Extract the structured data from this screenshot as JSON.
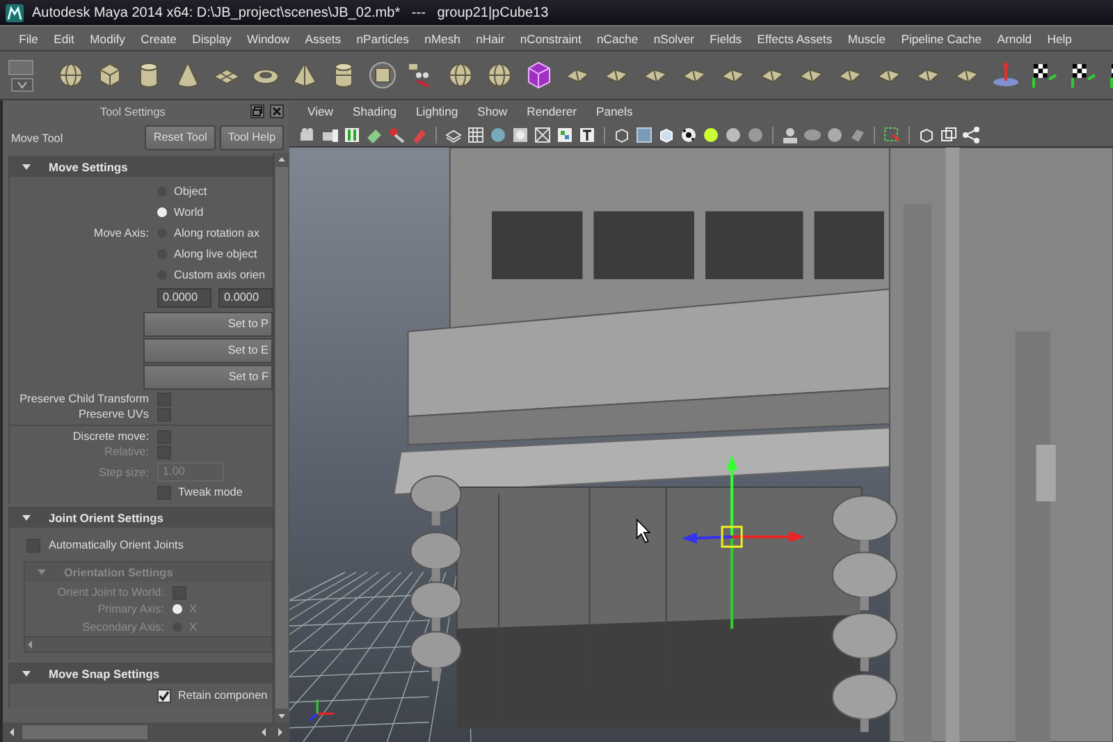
{
  "window": {
    "title": "Autodesk Maya 2014 x64: D:\\JB_project\\scenes\\JB_02.mb*   ---   group21|pCube13"
  },
  "menu": [
    "File",
    "Edit",
    "Modify",
    "Create",
    "Display",
    "Window",
    "Assets",
    "nParticles",
    "nMesh",
    "nHair",
    "nConstraint",
    "nCache",
    "nSolver",
    "Fields",
    "Effects Assets",
    "Muscle",
    "Pipeline Cache",
    "Arnold",
    "Help"
  ],
  "tool_settings": {
    "title": "Tool Settings",
    "tool_name": "Move Tool",
    "buttons": [
      "Reset Tool",
      "Tool Help"
    ],
    "sections": [
      {
        "title": "Move Settings",
        "expanded": true,
        "rows": [
          {
            "kind": "radio",
            "label": "Move Axis:",
            "options": [
              {
                "label": "Object",
                "selected": false
              },
              {
                "label": "World",
                "selected": true
              },
              {
                "label": "Along rotation ax",
                "selected": false
              },
              {
                "label": "Along live object",
                "selected": false
              },
              {
                "label": "Custom axis orien",
                "selected": false
              }
            ]
          },
          {
            "kind": "fields",
            "values": [
              "0.0000",
              "0.0000"
            ]
          },
          {
            "kind": "button",
            "label": "Set to P"
          },
          {
            "kind": "button",
            "label": "Set to E"
          },
          {
            "kind": "button",
            "label": "Set to F"
          },
          {
            "kind": "checkbox",
            "label": "Preserve Child Transform",
            "checked": false,
            "disabled": false
          },
          {
            "kind": "checkbox",
            "label": "Preserve UVs",
            "checked": false,
            "disabled": false
          },
          {
            "kind": "divider"
          },
          {
            "kind": "checkbox",
            "label": "Discrete move:",
            "checked": false,
            "disabled": false
          },
          {
            "kind": "checkbox",
            "label": "Relative:",
            "checked": false,
            "disabled": true
          },
          {
            "kind": "field",
            "label": "Step size:",
            "value": "1.00",
            "disabled": true
          },
          {
            "kind": "checkbox-right",
            "label": "Tweak mode",
            "checked": false,
            "disabled": false
          }
        ]
      },
      {
        "title": "Joint Orient Settings",
        "expanded": true,
        "rows": [
          {
            "kind": "checkbox-left",
            "label": "Automatically Orient Joints",
            "checked": false,
            "disabled": false
          },
          {
            "kind": "subsection",
            "title": "Orientation Settings",
            "expanded": true,
            "disabled": true,
            "rows": [
              {
                "kind": "checkbox",
                "label": "Orient Joint to World:",
                "checked": false,
                "disabled": true
              },
              {
                "kind": "radio",
                "label": "Primary Axis:",
                "disabled": true,
                "options": [
                  {
                    "label": "X",
                    "selected": true
                  }
                ]
              },
              {
                "kind": "radio",
                "label": "Secondary Axis:",
                "disabled": true,
                "options": [
                  {
                    "label": "X",
                    "selected": false
                  }
                ]
              }
            ]
          }
        ]
      },
      {
        "title": "Move Snap Settings",
        "expanded": true,
        "rows": [
          {
            "kind": "checkbox-right",
            "label": "Retain componen",
            "checked": true,
            "disabled": false
          }
        ]
      }
    ]
  },
  "viewport": {
    "menu": [
      "View",
      "Shading",
      "Lighting",
      "Show",
      "Renderer",
      "Panels"
    ]
  }
}
